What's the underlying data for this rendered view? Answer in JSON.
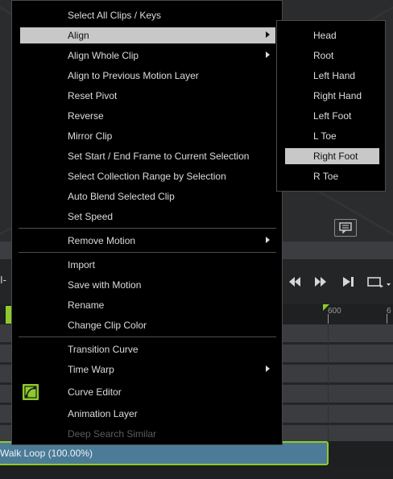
{
  "context_menu": {
    "items": [
      {
        "label": "Select All Clips / Keys"
      },
      {
        "label": "Align",
        "highlighted": true,
        "has_submenu": true
      },
      {
        "label": "Align Whole Clip",
        "has_submenu": true
      },
      {
        "label": "Align to Previous Motion Layer"
      },
      {
        "label": "Reset Pivot"
      },
      {
        "label": "Reverse"
      },
      {
        "label": "Mirror Clip"
      },
      {
        "label": "Set Start / End Frame to Current Selection"
      },
      {
        "label": "Select Collection Range by Selection"
      },
      {
        "label": "Auto Blend Selected Clip"
      },
      {
        "label": "Set Speed"
      },
      {
        "label": "Remove Motion",
        "has_submenu": true
      },
      {
        "label": "Import"
      },
      {
        "label": "Save with Motion"
      },
      {
        "label": "Rename"
      },
      {
        "label": "Change Clip Color"
      },
      {
        "label": "Transition Curve"
      },
      {
        "label": "Time Warp",
        "has_submenu": true
      },
      {
        "label": "Curve Editor",
        "icon": "curve-editor-icon"
      },
      {
        "label": "Animation Layer"
      },
      {
        "label": "Deep Search Similar",
        "disabled": true
      }
    ]
  },
  "align_submenu": {
    "items": [
      {
        "label": "Head"
      },
      {
        "label": "Root"
      },
      {
        "label": "Left Hand"
      },
      {
        "label": "Right Hand"
      },
      {
        "label": "Left Foot"
      },
      {
        "label": "L Toe"
      },
      {
        "label": "Right Foot",
        "highlighted": true
      },
      {
        "label": "R Toe"
      }
    ]
  },
  "timeline": {
    "ruler_label_1": "600",
    "ruler_label_2": "6",
    "clip_label": "Walk Loop (100.00%)",
    "left_stub_text": "I-"
  },
  "colors": {
    "menu_background": "#000000",
    "highlight": "#c8c8c8",
    "accent_green": "#8ecb2a",
    "clip_blue": "#4b7b97",
    "disabled_text": "#5c5c5c"
  }
}
